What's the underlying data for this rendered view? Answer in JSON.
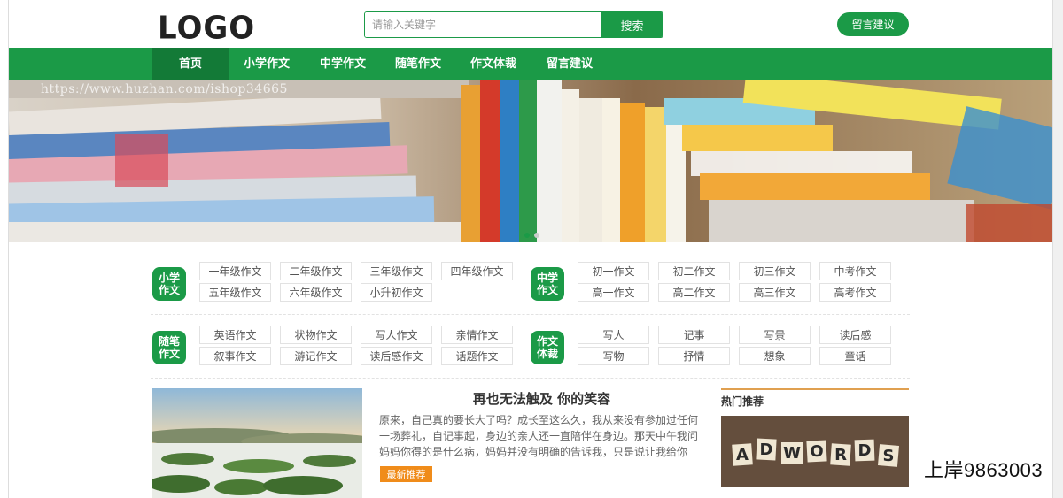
{
  "header": {
    "logo": "LOGO",
    "search_placeholder": "请输入关键字",
    "search_button": "搜索",
    "message_button": "留言建议"
  },
  "nav": {
    "items": [
      "首页",
      "小学作文",
      "中学作文",
      "随笔作文",
      "作文体裁",
      "留言建议"
    ],
    "active": "首页"
  },
  "banner": {
    "watermark": "https://www.huzhan.com/ishop34665",
    "slides": 2,
    "active_slide": 1
  },
  "categories": {
    "primary": {
      "label": "小学作文",
      "tags": [
        "一年级作文",
        "二年级作文",
        "三年级作文",
        "四年级作文",
        "五年级作文",
        "六年级作文",
        "小升初作文"
      ]
    },
    "middle": {
      "label": "中学作文",
      "tags": [
        "初一作文",
        "初二作文",
        "初三作文",
        "中考作文",
        "高一作文",
        "高二作文",
        "高三作文",
        "高考作文"
      ]
    },
    "essay": {
      "label": "随笔作文",
      "tags": [
        "英语作文",
        "状物作文",
        "写人作文",
        "亲情作文",
        "叙事作文",
        "游记作文",
        "读后感作文",
        "话题作文"
      ]
    },
    "genre": {
      "label": "作文体裁",
      "tags": [
        "写人",
        "记事",
        "写景",
        "读后感",
        "写物",
        "抒情",
        "想象",
        "童话"
      ]
    }
  },
  "article": {
    "title": "再也无法触及 你的笑容",
    "excerpt": "原来，自己真的要长大了吗？成长至这么久，我从来没有参加过任何一场葬礼，自记事起，身边的亲人还一直陪伴在身边。那天中午我问妈妈你得的是什么病，妈妈并没有明确的告诉我，只是说让我给你打...",
    "badge": "最新推荐"
  },
  "hot": {
    "title": "热门推荐",
    "tiles": [
      "A",
      "D",
      "W",
      "O",
      "R",
      "D",
      "S"
    ]
  },
  "overlay_text": "上岸9863003",
  "colors": {
    "brand_green": "#1b9a47",
    "nav_active": "#137a37",
    "badge_orange": "#f08c1a"
  }
}
